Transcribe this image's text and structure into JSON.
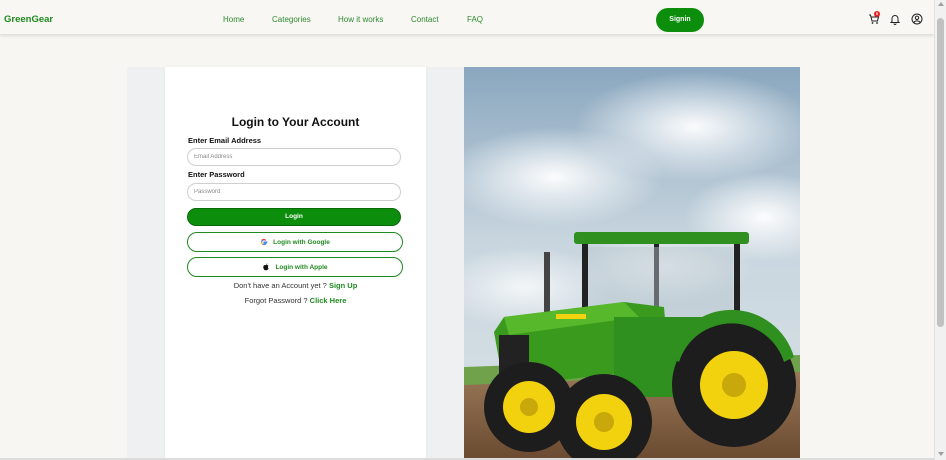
{
  "header": {
    "brand": "GreenGear",
    "nav": [
      {
        "label": "Home"
      },
      {
        "label": "Categories"
      },
      {
        "label": "How it works"
      },
      {
        "label": "Contact"
      },
      {
        "label": "FAQ"
      }
    ],
    "signin_label": "Signin",
    "cart_count": "0",
    "icons": [
      "cart-icon",
      "bell-icon",
      "user-icon"
    ]
  },
  "login": {
    "title": "Login to Your Account",
    "email_label": "Enter Email Address",
    "email_placeholder": "Email Address",
    "email_value": "",
    "password_label": "Enter Password",
    "password_placeholder": "Password",
    "password_value": "",
    "login_label": "Login",
    "google_label": "Login with Google",
    "apple_label": "Login with Apple",
    "signup_prompt": "Don't have an Account yet ?",
    "signup_link": "Sign Up",
    "forgot_prompt": "Forgot Password ?",
    "forgot_link": "Click Here"
  },
  "colors": {
    "brand_green": "#0c8e0c",
    "link_green": "#1f8a1f",
    "badge_red": "#e02020"
  }
}
